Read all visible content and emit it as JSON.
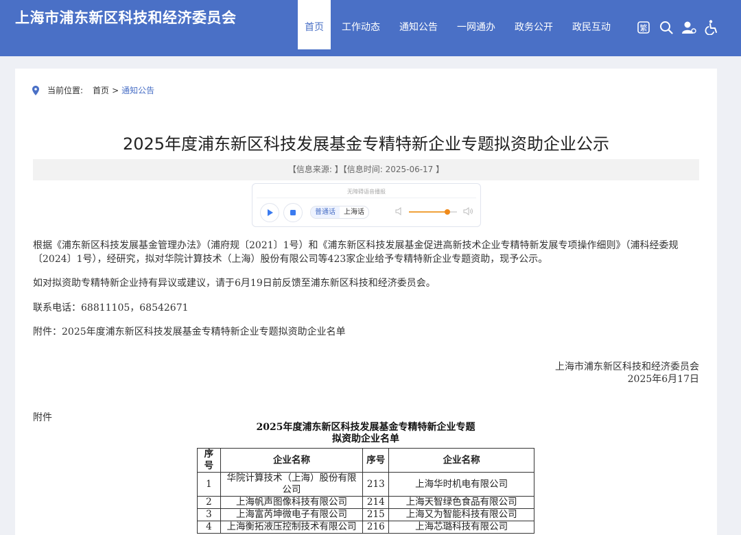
{
  "header": {
    "site_title": "上海市浦东新区科技和经济委员会",
    "nav": [
      "首页",
      "工作动态",
      "通知公告",
      "一网通办",
      "政务公开",
      "政民互动"
    ],
    "tools": [
      "繁",
      "search-icon",
      "user-icon",
      "accessibility-icon"
    ]
  },
  "breadcrumb": {
    "label": "当前位置:",
    "home": "首页",
    "separator": ">",
    "current": "通知公告"
  },
  "article": {
    "title": "2025年度浦东新区科技发展基金专精特新企业专题拟资助企业公示",
    "meta": "【信息来源: 】【信息时间: 2025-06-17 】",
    "player": {
      "label": "无障碍语音播报",
      "lang_mandarin": "普通话",
      "lang_shanghai": "上海话",
      "volume": 0.8
    },
    "paragraphs": [
      "根据《浦东新区科技发展基金管理办法》（浦府规〔2021〕1号）和《浦东新区科技发展基金促进高新技术企业专精特新发展专项操作细则》（浦科经委规〔2024〕1号），经研究，拟对华院计算技术（上海）股份有限公司等423家企业给予专精特新企业专题资助，现予公示。",
      "如对拟资助专精特新企业持有异议或建议，请于6月19日前反馈至浦东新区科技和经济委员会。",
      "联系电话：68811105，68542671",
      "附件：2025年度浦东新区科技发展基金专精特新企业专题拟资助企业名单"
    ],
    "signature_org": "上海市浦东新区科技和经济委员会",
    "signature_date": "2025年6月17日",
    "attachment_label": "附件"
  },
  "list": {
    "title_line1": "2025年度浦东新区科技发展基金专精特新企业专题",
    "title_line2": "拟资助企业名单",
    "headers": [
      "序号",
      "企业名称",
      "序号",
      "企业名称"
    ],
    "rows": [
      [
        "1",
        "华院计算技术（上海）股份有限公司",
        "213",
        "上海华时机电有限公司"
      ],
      [
        "2",
        "上海帆声图像科技有限公司",
        "214",
        "上海天智绿色食品有限公司"
      ],
      [
        "3",
        "上海富芮坤微电子有限公司",
        "215",
        "上海又为智能科技有限公司"
      ],
      [
        "4",
        "上海衡拓液压控制技术有限公司",
        "216",
        "上海芯璐科技有限公司"
      ]
    ]
  },
  "colors": {
    "header_bg": "#4a70c6",
    "accent": "#4a70c6",
    "volume_fill": "#f0a23a"
  }
}
